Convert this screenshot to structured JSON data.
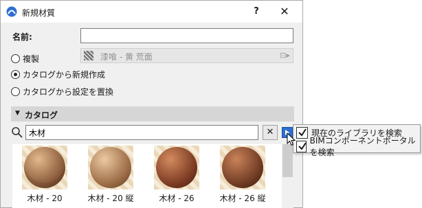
{
  "window": {
    "title": "新規材質",
    "help_label": "?",
    "close_label": "✕"
  },
  "form": {
    "name_label": "名前:",
    "name_value": "",
    "options": [
      {
        "label": "複製",
        "selected": false
      },
      {
        "label": "カタログから新規作成",
        "selected": true
      },
      {
        "label": "カタログから設定を置換",
        "selected": false
      }
    ],
    "duplicate_source": "漆喰 - 黄 荒面"
  },
  "catalog": {
    "title": "カタログ",
    "search_value": "木材",
    "clear_label": "✕",
    "results": [
      {
        "label": "木材 - 20",
        "color": "#8a5a3a"
      },
      {
        "label": "木材 - 20 縦",
        "color": "#9a6a45"
      },
      {
        "label": "木材 - 26",
        "color": "#7a3a22"
      },
      {
        "label": "木材 - 26 縦",
        "color": "#6e3a22"
      }
    ]
  },
  "search_options": {
    "items": [
      {
        "label": "現在のライブラリを検索",
        "checked": true
      },
      {
        "label": "BIMコンポーネントポータルを検索",
        "checked": true
      }
    ]
  },
  "colors": {
    "accent": "#2d6fd0",
    "catalog_header": "#d6d6d6"
  }
}
